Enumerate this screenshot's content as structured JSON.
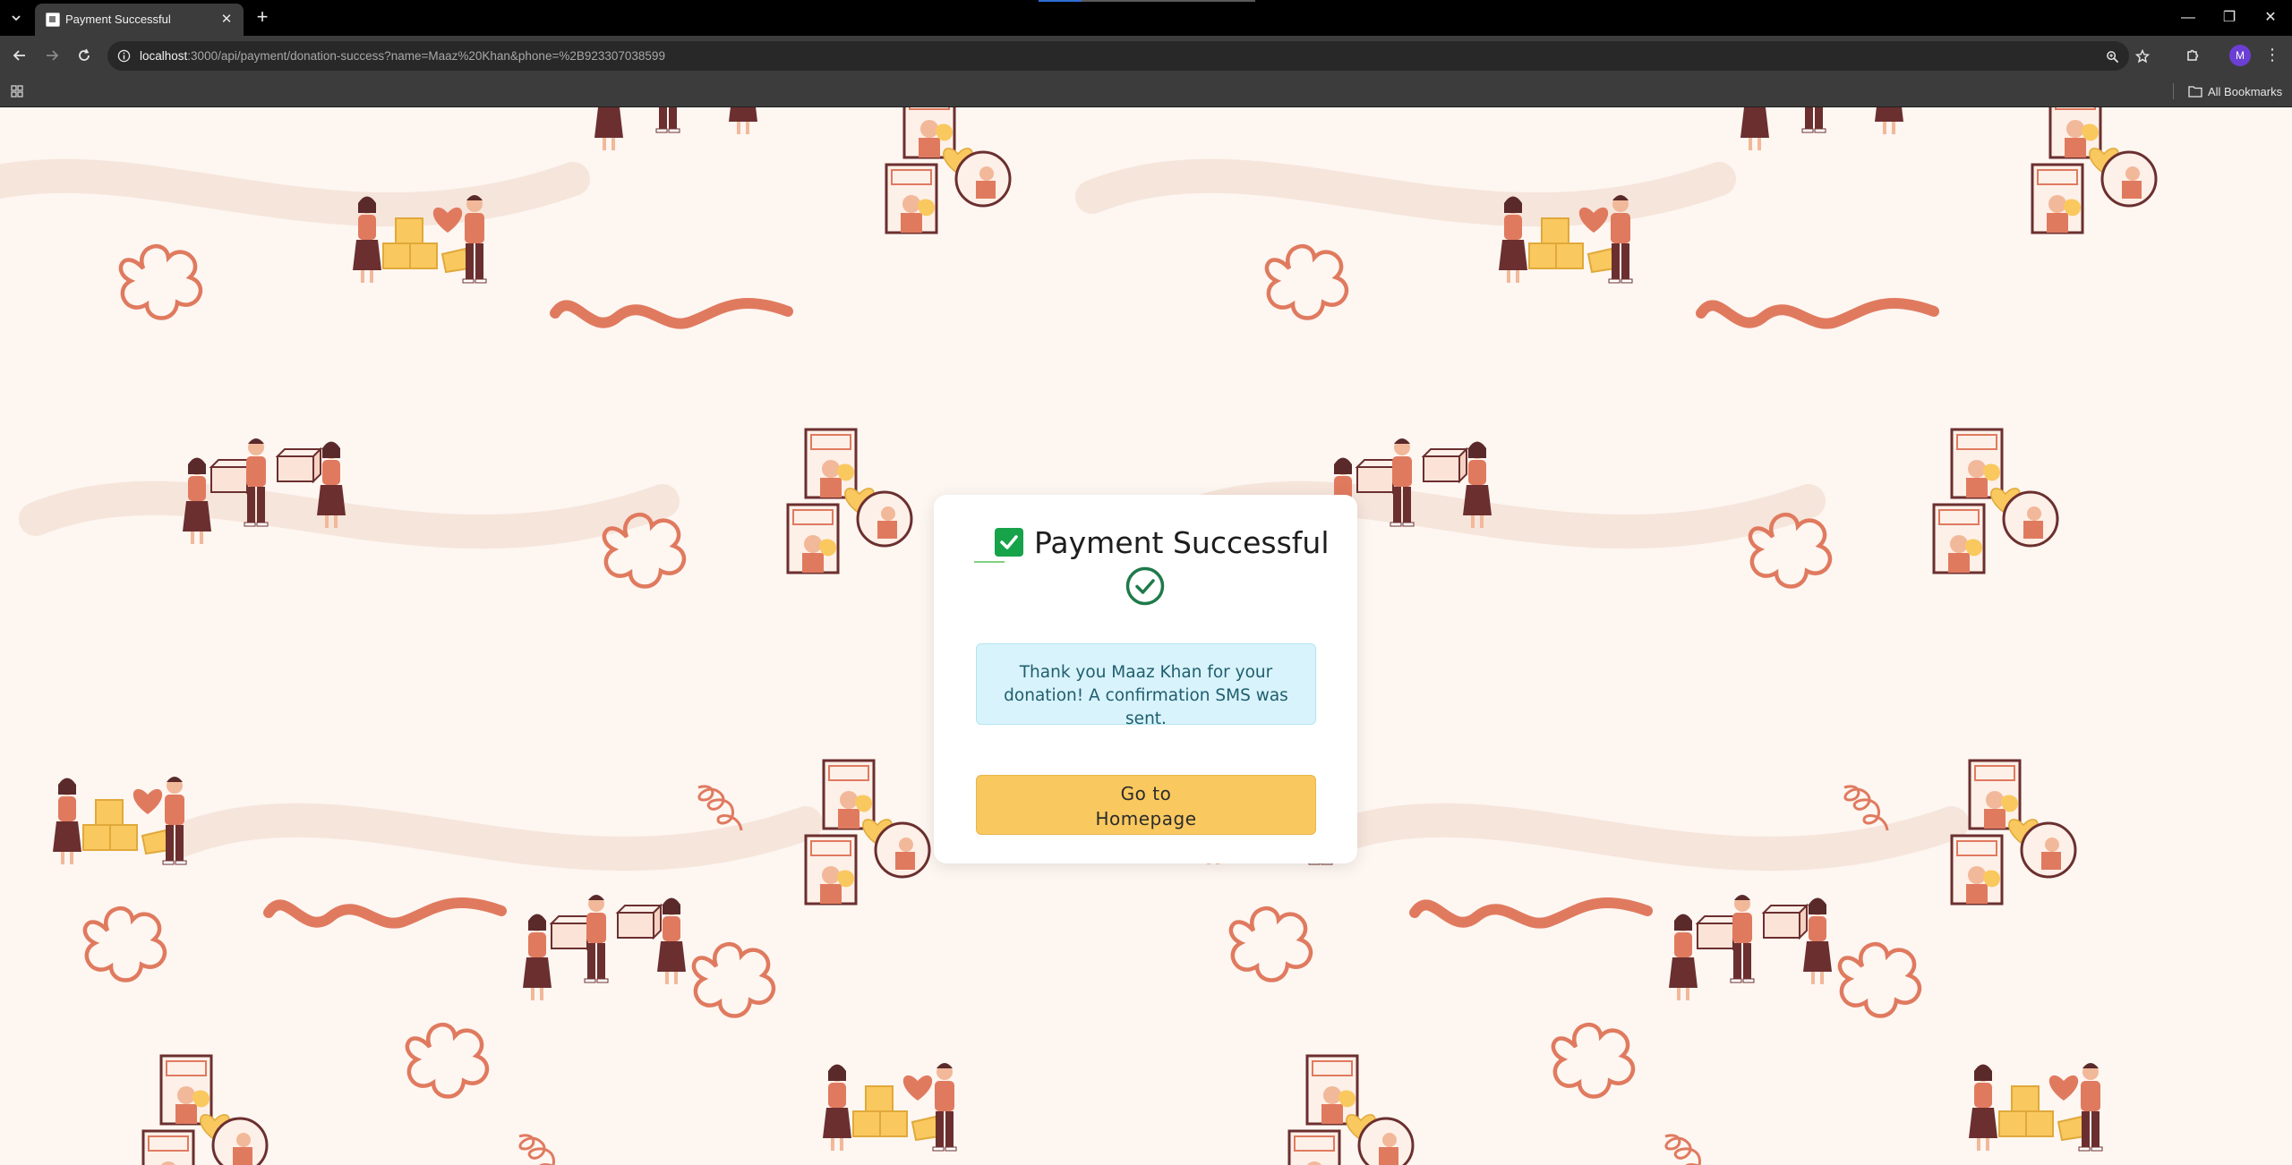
{
  "browser": {
    "tab_title": "Payment Successful",
    "url_host": "localhost",
    "url_rest": ":3000/api/payment/donation-success?name=Maaz%20Khan&phone=%2B923307038599",
    "profile_initial": "M",
    "bookmarks_label": "All Bookmarks"
  },
  "card": {
    "title": "Payment Successful",
    "message": "Thank you Maaz Khan for your donation! A confirmation SMS was sent.",
    "button_label": "Go to Homepage"
  },
  "colors": {
    "accent_yellow": "#f9c85f",
    "success_green": "#16a34a",
    "circle_green": "#1e7a4a",
    "message_bg": "#d8f3fb",
    "page_bg": "#fdf6f1",
    "pattern_salmon": "#e07a5f",
    "pattern_maroon": "#6b2f2f"
  },
  "icons": {
    "title_emoji": "check-mark-button-icon",
    "success": "circle-check-icon"
  }
}
